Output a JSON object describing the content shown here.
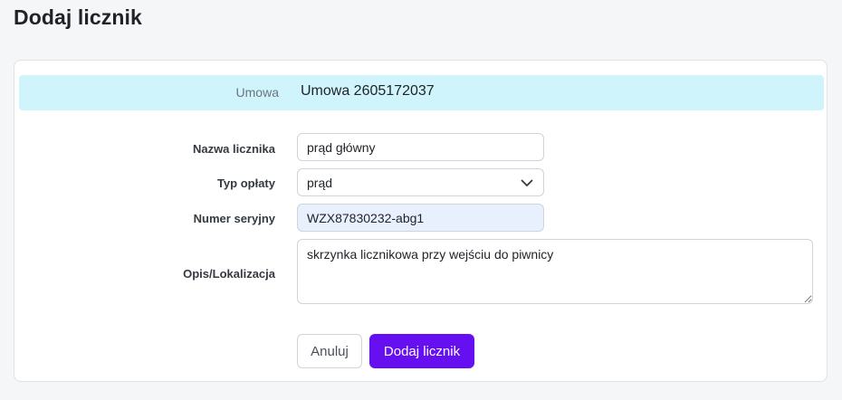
{
  "page": {
    "title": "Dodaj licznik"
  },
  "contract": {
    "label": "Umowa",
    "value": "Umowa 2605172037"
  },
  "form": {
    "meter_name": {
      "label": "Nazwa licznika",
      "value": "prąd główny"
    },
    "fee_type": {
      "label": "Typ opłaty",
      "selected": "prąd",
      "icon": "chevron-down-icon"
    },
    "serial_number": {
      "label": "Numer seryjny",
      "value": "WZX87830232-abg1"
    },
    "description": {
      "label": "Opis/Lokalizacja",
      "value": "skrzynka licznikowa przy wejściu do piwnicy"
    }
  },
  "actions": {
    "cancel_label": "Anuluj",
    "submit_label": "Dodaj licznik"
  },
  "colors": {
    "accent": "#6610f2",
    "info_row": "#cff4fc",
    "autofill": "#e8f0fe"
  }
}
